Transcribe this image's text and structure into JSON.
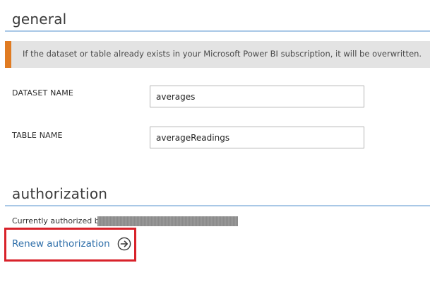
{
  "general": {
    "title": "general",
    "notice": "If the dataset or table already exists in your Microsoft Power BI subscription, it will be overwritten.",
    "dataset_name_label": "DATASET NAME",
    "dataset_name_value": "averages",
    "table_name_label": "TABLE NAME",
    "table_name_value": "averageReadings"
  },
  "authorization": {
    "title": "authorization",
    "currently_authorized_label": "Currently authorized by",
    "renew_link_label": "Renew authorization",
    "renew_icon": "arrow-right-circle-icon"
  },
  "colors": {
    "accent_rule": "#a9c8e6",
    "notice_bar": "#e07b22",
    "link": "#2f6faa",
    "highlight": "#d8222a"
  }
}
